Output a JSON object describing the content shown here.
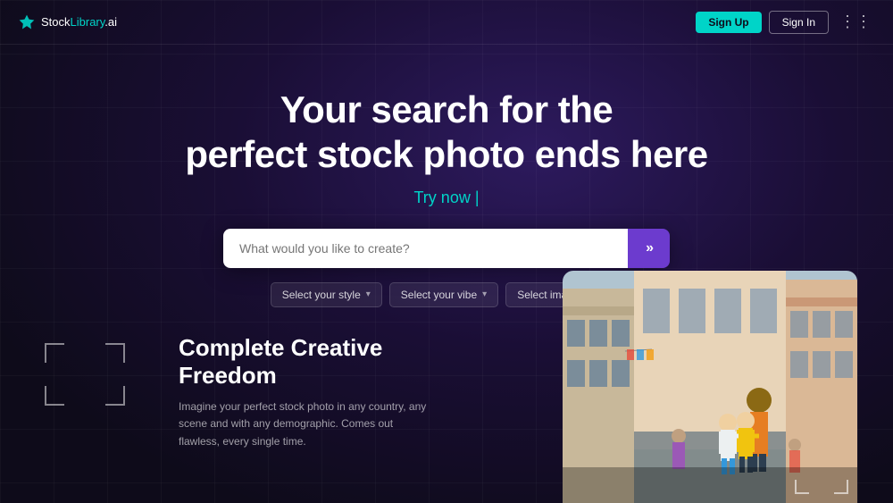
{
  "brand": {
    "name_prefix": "Stock",
    "name_suffix": "Library",
    "name_ext": ".ai",
    "logo_color": "#00d4c8"
  },
  "navbar": {
    "signup_label": "Sign Up",
    "signin_label": "Sign In"
  },
  "hero": {
    "title_line1": "Your search for the",
    "title_line2": "perfect stock photo ends here",
    "cta_label": "Try now |"
  },
  "search": {
    "placeholder": "What would you like to create?",
    "button_icon": "»"
  },
  "filters": [
    {
      "label": "Select your style",
      "id": "style-filter"
    },
    {
      "label": "Select your vibe",
      "id": "vibe-filter"
    },
    {
      "label": "Select image size",
      "id": "size-filter"
    }
  ],
  "creative_section": {
    "title": "Complete Creative Freedom",
    "description": "Imagine your perfect stock photo in any country, any scene and with any demographic. Comes out flawless, every single time."
  }
}
